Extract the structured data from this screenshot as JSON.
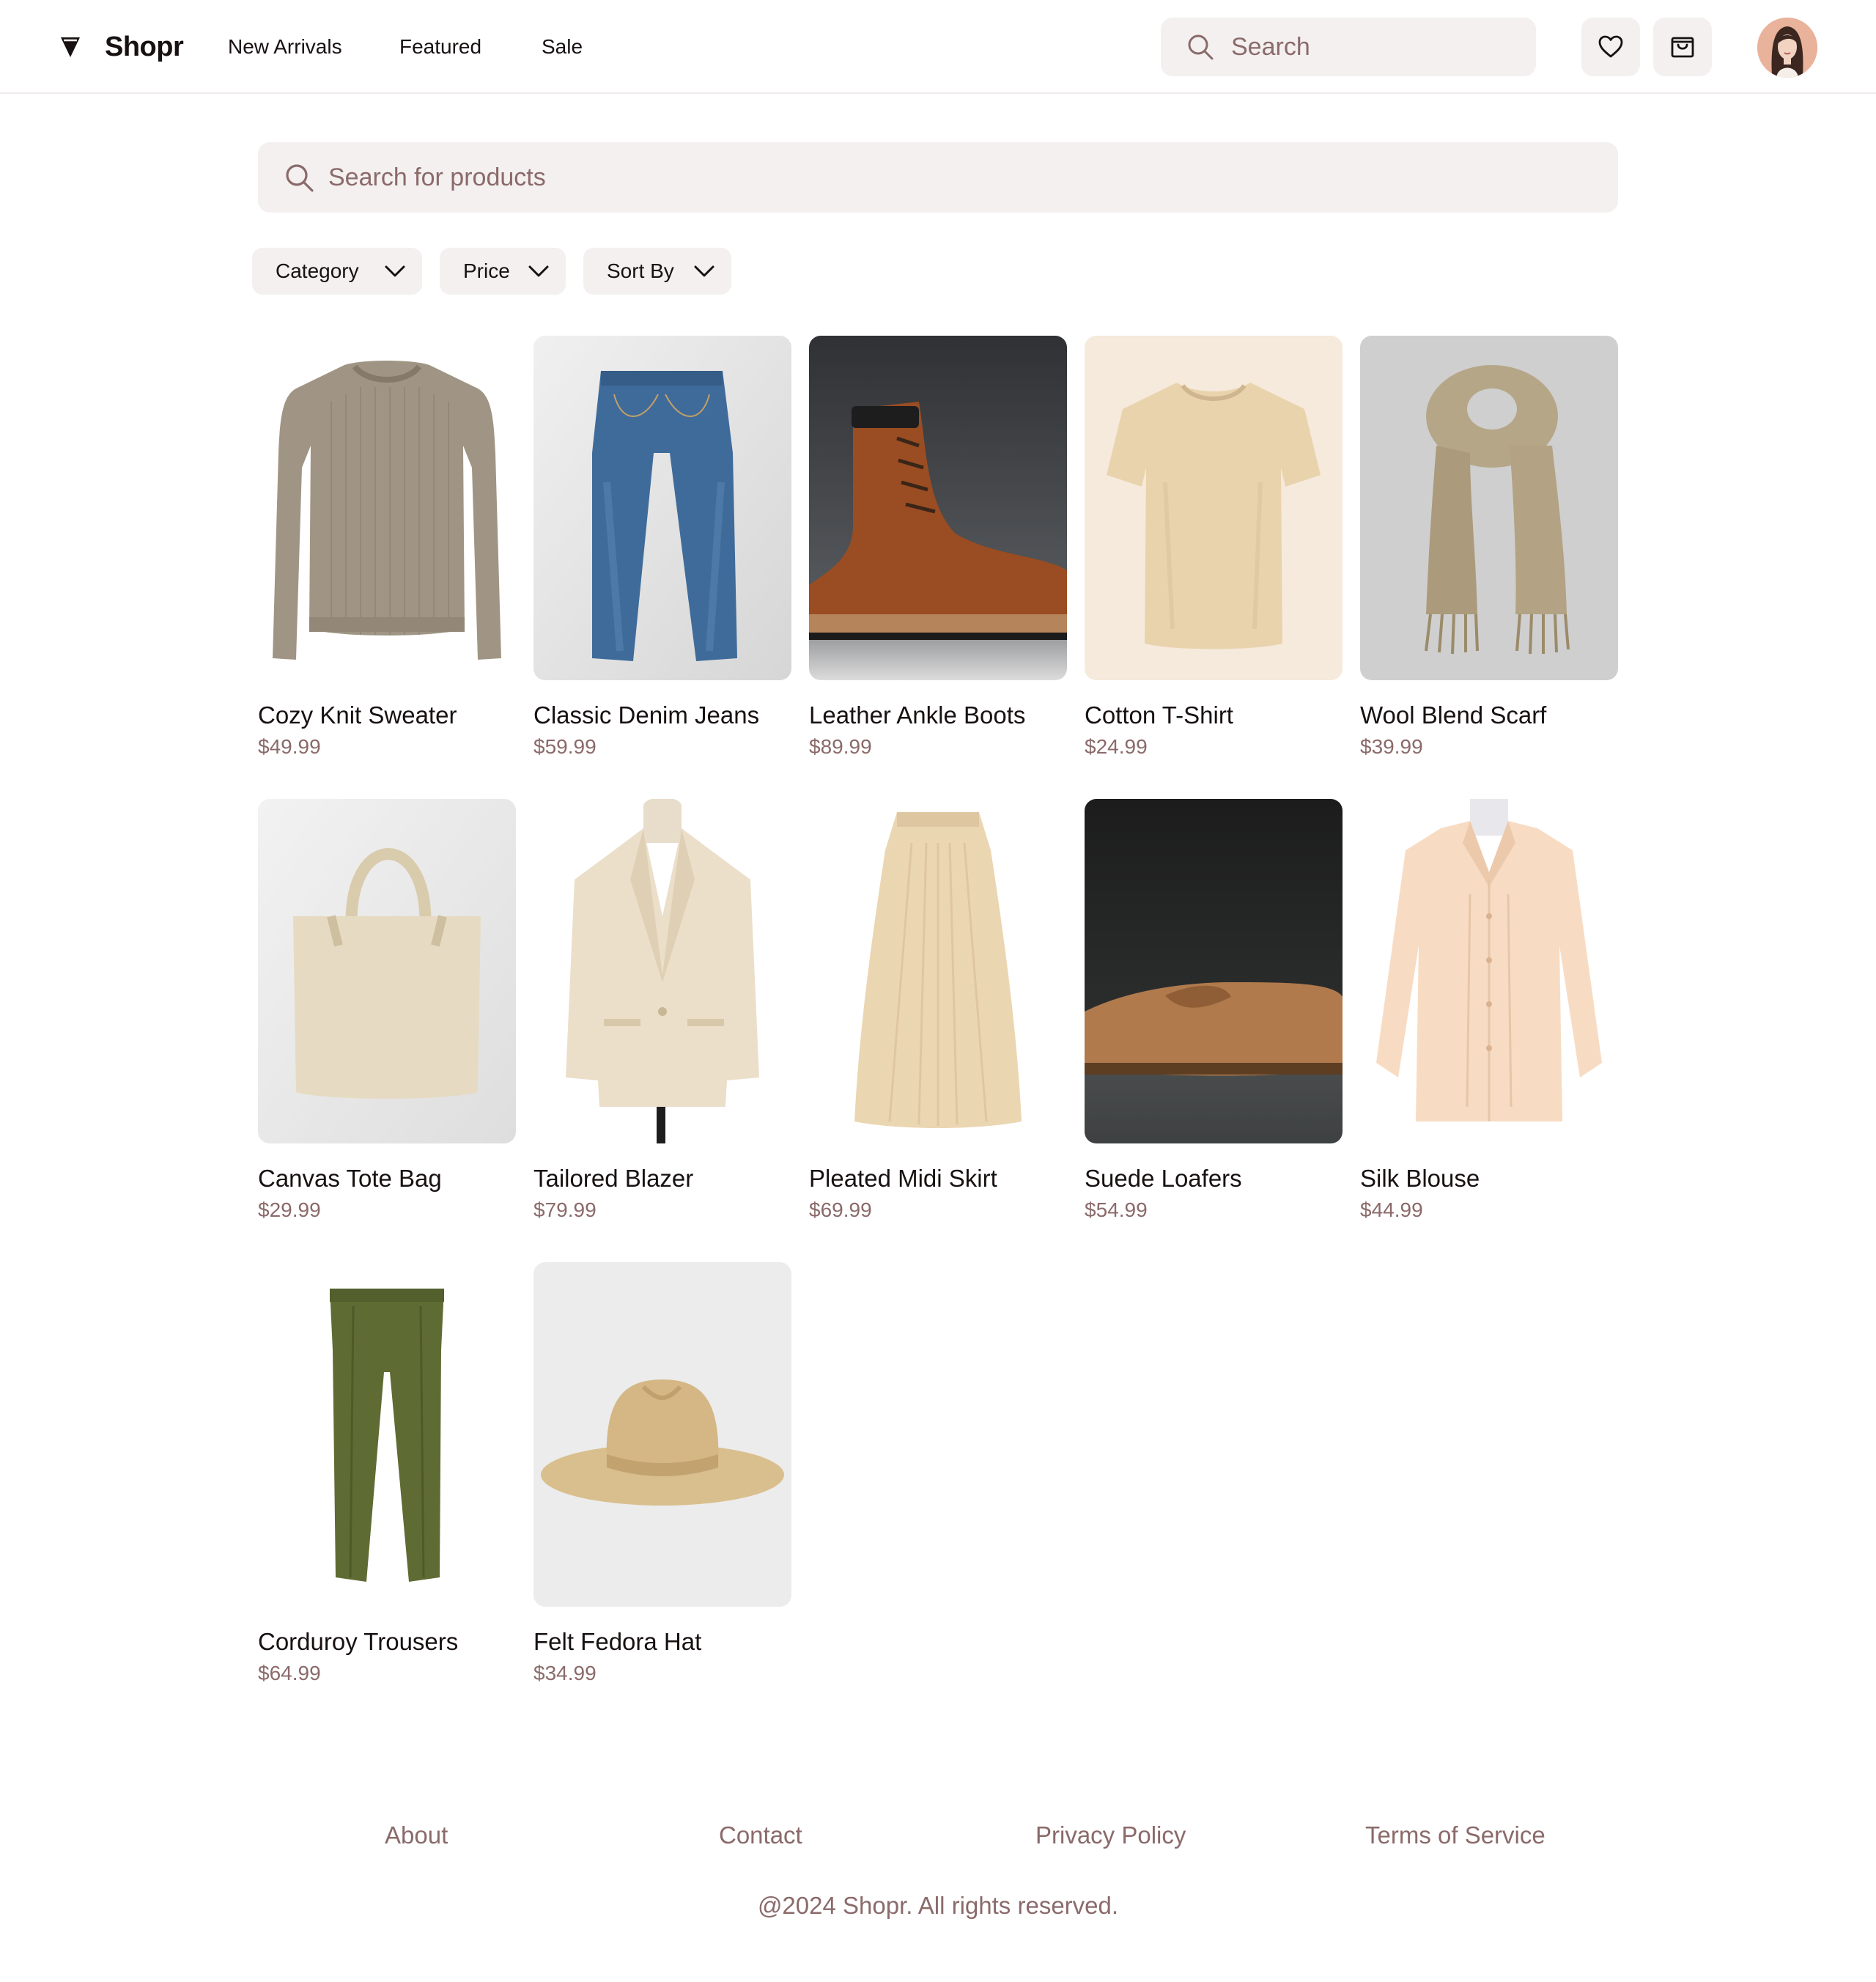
{
  "header": {
    "brand": "Shopr",
    "nav": [
      "New Arrivals",
      "Featured",
      "Sale"
    ],
    "search_placeholder": "Search"
  },
  "search": {
    "placeholder": "Search for products"
  },
  "filters": [
    "Category",
    "Price",
    "Sort By"
  ],
  "products": [
    {
      "name": "Cozy Knit Sweater",
      "price": "$49.99"
    },
    {
      "name": "Classic Denim Jeans",
      "price": "$59.99"
    },
    {
      "name": "Leather Ankle Boots",
      "price": "$89.99"
    },
    {
      "name": "Cotton T-Shirt",
      "price": "$24.99"
    },
    {
      "name": "Wool Blend Scarf",
      "price": "$39.99"
    },
    {
      "name": "Canvas Tote Bag",
      "price": "$29.99"
    },
    {
      "name": "Tailored Blazer",
      "price": "$79.99"
    },
    {
      "name": "Pleated Midi Skirt",
      "price": "$69.99"
    },
    {
      "name": "Suede Loafers",
      "price": "$54.99"
    },
    {
      "name": "Silk Blouse",
      "price": "$44.99"
    },
    {
      "name": "Corduroy Trousers",
      "price": "$64.99"
    },
    {
      "name": "Felt Fedora Hat",
      "price": "$34.99"
    }
  ],
  "footer": {
    "links": [
      "About",
      "Contact",
      "Privacy Policy",
      "Terms of Service"
    ],
    "copyright": "@2024 Shopr. All rights reserved."
  },
  "icons": {
    "logo": "logo-icon",
    "search": "search-icon",
    "favorites": "heart-icon",
    "cart": "shopping-bag-icon",
    "dropdown": "chevron-down-icon"
  },
  "colors": {
    "text": "#181111",
    "muted": "#8b6a6a",
    "surface": "#f4f0f0",
    "border": "#f1ecec"
  }
}
